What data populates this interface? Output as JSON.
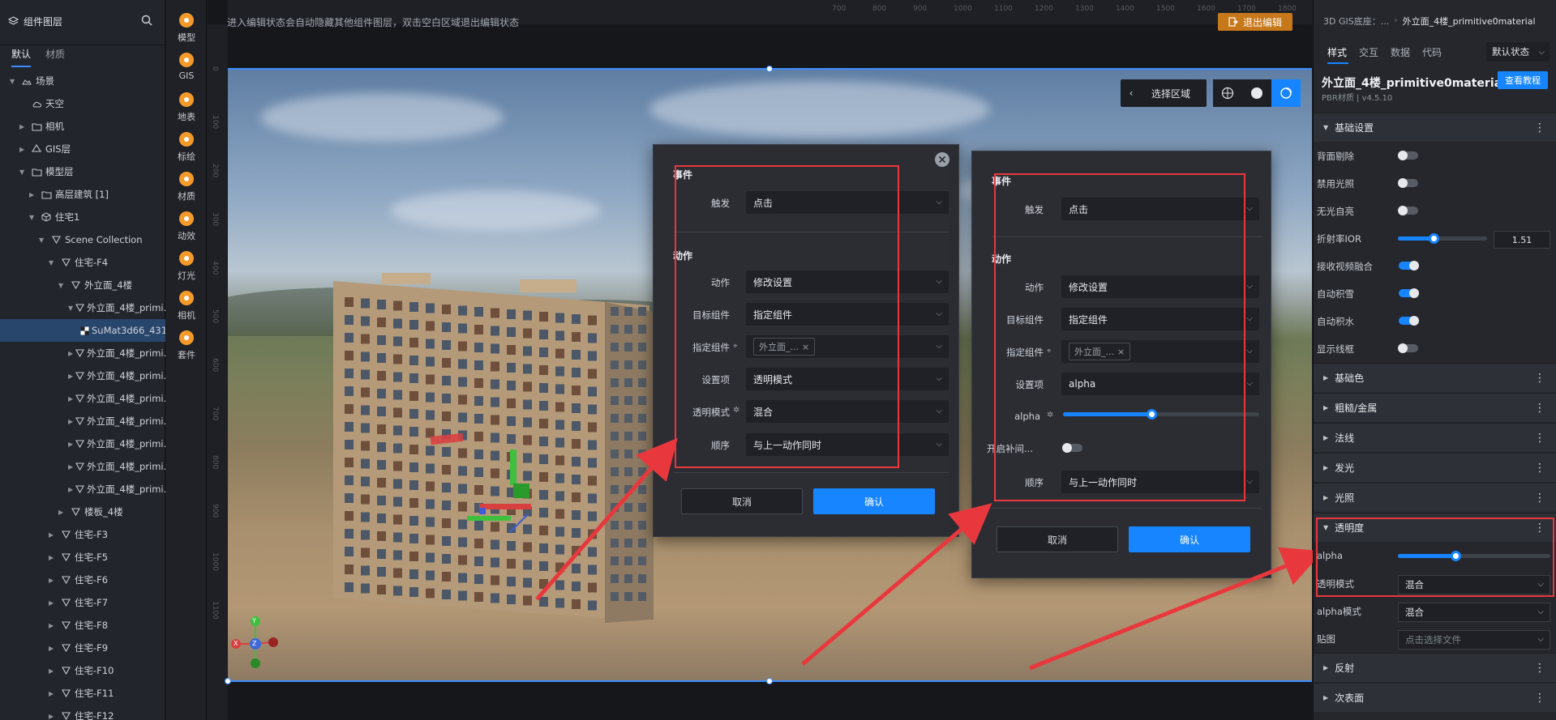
{
  "left_panel": {
    "title": "组件图层",
    "tabs": [
      "默认",
      "材质"
    ],
    "tree": [
      {
        "label": "场景",
        "depth": 0,
        "icon": "scene-icon",
        "expanded": true
      },
      {
        "label": "天空",
        "depth": 1,
        "icon": "sky-icon"
      },
      {
        "label": "相机",
        "depth": 1,
        "icon": "folder-icon",
        "collapsed": true
      },
      {
        "label": "GIS层",
        "depth": 1,
        "icon": "gis-layer-icon",
        "collapsed": true
      },
      {
        "label": "模型层",
        "depth": 1,
        "icon": "folder-icon",
        "expanded": true
      },
      {
        "label": "高层建筑 [1]",
        "depth": 2,
        "icon": "folder-icon",
        "collapsed": true
      },
      {
        "label": "住宅1",
        "depth": 2,
        "icon": "cube-icon",
        "expanded": true
      },
      {
        "label": "Scene Collection",
        "depth": 3,
        "icon": "mesh-icon",
        "expanded": true
      },
      {
        "label": "住宅-F4",
        "depth": 4,
        "icon": "mesh-icon",
        "expanded": true
      },
      {
        "label": "外立面_4楼",
        "depth": 5,
        "icon": "mesh-icon",
        "expanded": true
      },
      {
        "label": "外立面_4楼_primi...",
        "depth": 6,
        "icon": "mesh-icon",
        "expanded": true
      },
      {
        "label": "SuMat3d66_431...",
        "depth": 7,
        "icon": "material-icon",
        "selected": true
      },
      {
        "label": "外立面_4楼_primi...",
        "depth": 6,
        "icon": "mesh-icon",
        "collapsed": true
      },
      {
        "label": "外立面_4楼_primi...",
        "depth": 6,
        "icon": "mesh-icon",
        "collapsed": true
      },
      {
        "label": "外立面_4楼_primi...",
        "depth": 6,
        "icon": "mesh-icon",
        "collapsed": true
      },
      {
        "label": "外立面_4楼_primi...",
        "depth": 6,
        "icon": "mesh-icon",
        "collapsed": true
      },
      {
        "label": "外立面_4楼_primi...",
        "depth": 6,
        "icon": "mesh-icon",
        "collapsed": true
      },
      {
        "label": "外立面_4楼_primi...",
        "depth": 6,
        "icon": "mesh-icon",
        "collapsed": true
      },
      {
        "label": "外立面_4楼_primi...",
        "depth": 6,
        "icon": "mesh-icon",
        "collapsed": true
      },
      {
        "label": "楼板_4楼",
        "depth": 5,
        "icon": "mesh-icon",
        "collapsed": true
      },
      {
        "label": "住宅-F3",
        "depth": 4,
        "icon": "mesh-icon",
        "collapsed": true
      },
      {
        "label": "住宅-F5",
        "depth": 4,
        "icon": "mesh-icon",
        "collapsed": true
      },
      {
        "label": "住宅-F6",
        "depth": 4,
        "icon": "mesh-icon",
        "collapsed": true
      },
      {
        "label": "住宅-F7",
        "depth": 4,
        "icon": "mesh-icon",
        "collapsed": true
      },
      {
        "label": "住宅-F8",
        "depth": 4,
        "icon": "mesh-icon",
        "collapsed": true
      },
      {
        "label": "住宅-F9",
        "depth": 4,
        "icon": "mesh-icon",
        "collapsed": true
      },
      {
        "label": "住宅-F10",
        "depth": 4,
        "icon": "mesh-icon",
        "collapsed": true
      },
      {
        "label": "住宅-F11",
        "depth": 4,
        "icon": "mesh-icon",
        "collapsed": true
      },
      {
        "label": "住宅-F12",
        "depth": 4,
        "icon": "mesh-icon",
        "collapsed": true
      }
    ]
  },
  "toolbar": {
    "items": [
      {
        "label": "模型",
        "icon": "model-icon"
      },
      {
        "label": "GIS",
        "icon": "gis-icon"
      },
      {
        "label": "地表",
        "icon": "terrain-icon"
      },
      {
        "label": "标绘",
        "icon": "marker-icon"
      },
      {
        "label": "材质",
        "icon": "material-icon"
      },
      {
        "label": "动效",
        "icon": "effect-icon"
      },
      {
        "label": "灯光",
        "icon": "light-icon"
      },
      {
        "label": "相机",
        "icon": "camera-icon"
      },
      {
        "label": "套件",
        "icon": "kit-icon"
      }
    ]
  },
  "canvas": {
    "hint": "进入编辑状态会自动隐藏其他组件图层，双击空白区域退出编辑状态",
    "exit_label": "退出编辑",
    "select_area": "选择区域",
    "ruler_top": [
      "700",
      "800",
      "900",
      "1000",
      "1100",
      "1200",
      "1300",
      "1400",
      "1500",
      "1600",
      "1700",
      "1800"
    ],
    "ruler_left": [
      "0",
      "100",
      "200",
      "300",
      "400",
      "500",
      "600",
      "700",
      "800",
      "900",
      "1000",
      "1100"
    ],
    "axis_labels": {
      "x": "X",
      "y": "Y",
      "z": "Z"
    }
  },
  "dialog1": {
    "event_title": "事件",
    "trigger_label": "触发",
    "trigger_value": "点击",
    "action_title": "动作",
    "action_label": "动作",
    "action_value": "修改设置",
    "target_label": "目标组件",
    "target_value": "指定组件",
    "specify_label": "指定组件",
    "specify_chip": "外立面_...",
    "setting_label": "设置项",
    "setting_value": "透明模式",
    "mode_label": "透明模式",
    "mode_value": "混合",
    "order_label": "顺序",
    "order_value": "与上一动作同时",
    "cancel": "取消",
    "ok": "确认"
  },
  "dialog2": {
    "event_title": "事件",
    "trigger_label": "触发",
    "trigger_value": "点击",
    "action_title": "动作",
    "action_label": "动作",
    "action_value": "修改设置",
    "target_label": "目标组件",
    "target_value": "指定组件",
    "specify_label": "指定组件",
    "specify_chip": "外立面_...",
    "setting_label": "设置项",
    "setting_value": "alpha",
    "alpha_label": "alpha",
    "alpha_value": 0.45,
    "tween_label": "开启补间...",
    "tween_on": false,
    "order_label": "顺序",
    "order_value": "与上一动作同时",
    "cancel": "取消",
    "ok": "确认"
  },
  "right_panel": {
    "breadcrumb_root": "3D GIS底座：...",
    "breadcrumb_current": "外立面_4楼_primitive0material",
    "tabs": [
      "样式",
      "交互",
      "数据",
      "代码"
    ],
    "state_dropdown": "默认状态",
    "material_name": "外立面_4楼_primitive0material",
    "material_sub": "PBR材质 | v4.5.10",
    "tutorial": "查看教程",
    "basic_section": "基础设置",
    "props": {
      "backface": {
        "label": "背面剔除",
        "on": false
      },
      "nolight": {
        "label": "禁用光照",
        "on": false
      },
      "unlit": {
        "label": "无光自亮",
        "on": false
      },
      "ior": {
        "label": "折射率IOR",
        "value": "1.51",
        "fraction": 0.4
      },
      "video": {
        "label": "接收视频融合",
        "on": true
      },
      "snow": {
        "label": "自动积雪",
        "on": true
      },
      "water": {
        "label": "自动积水",
        "on": true
      },
      "wireframe": {
        "label": "显示线框",
        "on": false
      }
    },
    "sections": [
      "基础色",
      "粗糙/金属",
      "法线",
      "发光",
      "光照"
    ],
    "transparency": {
      "title": "透明度",
      "alpha_label": "alpha",
      "alpha_value": 0.38,
      "mode_label": "透明模式",
      "mode_value": "混合",
      "alpha_mode_label": "alpha模式",
      "alpha_mode_value": "混合",
      "map_label": "贴图",
      "map_placeholder": "点击选择文件"
    },
    "more_sections": [
      "反射",
      "次表面"
    ]
  },
  "colors": {
    "accent": "#1685ff",
    "annotation": "#e8383d",
    "exit": "#c7781a"
  }
}
